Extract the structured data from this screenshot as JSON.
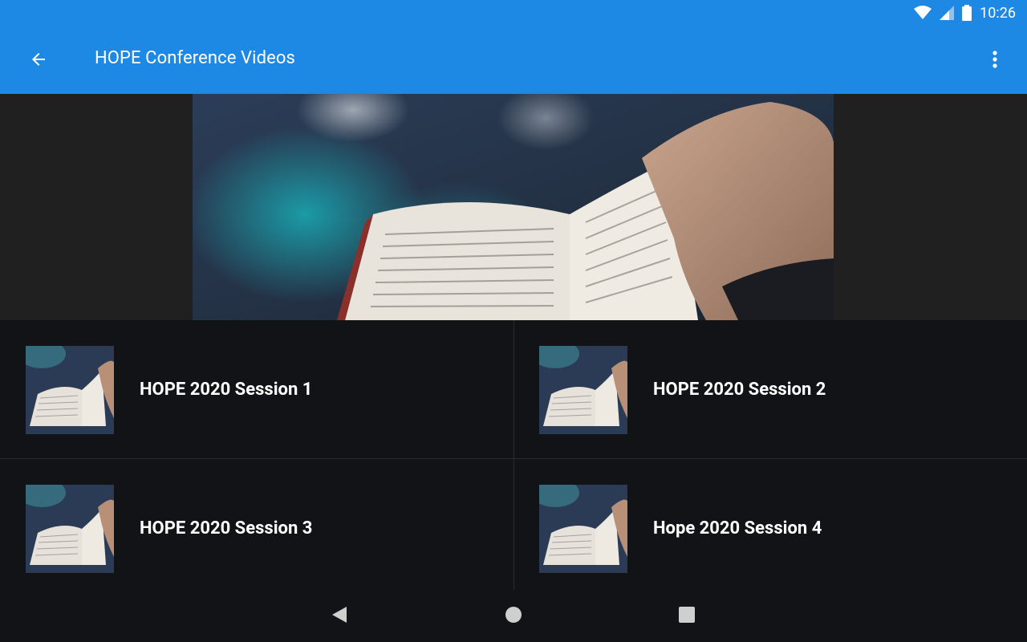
{
  "status": {
    "time": "10:26"
  },
  "header": {
    "title": "HOPE Conference Videos"
  },
  "sessions": [
    {
      "label": "HOPE 2020 Session 1"
    },
    {
      "label": "HOPE 2020 Session 2"
    },
    {
      "label": "HOPE 2020 Session 3"
    },
    {
      "label": "Hope 2020 Session 4"
    }
  ],
  "colors": {
    "appbar": "#1e88e5",
    "background": "#121316"
  },
  "icons": {
    "back": "arrow-back-icon",
    "menu": "more-vert-icon",
    "wifi": "wifi-icon",
    "signal": "signal-icon",
    "battery": "battery-icon"
  }
}
